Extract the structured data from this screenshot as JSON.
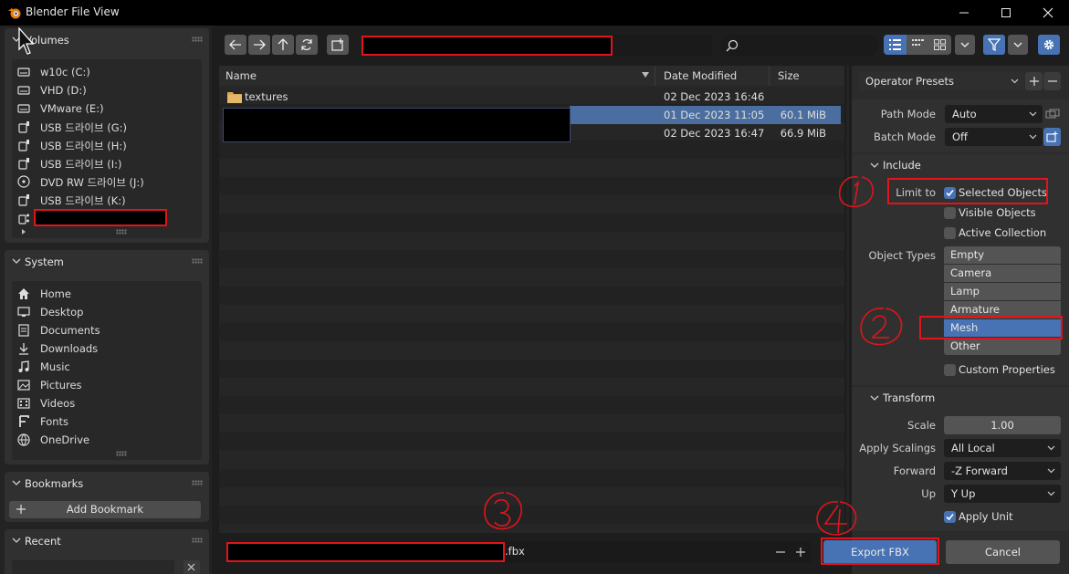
{
  "window": {
    "title": "Blender File View"
  },
  "sidebar": {
    "volumes": {
      "title": "Volumes",
      "items": [
        {
          "label": "w10c (C:)",
          "icon": "disk-icon"
        },
        {
          "label": "VHD (D:)",
          "icon": "disk-icon"
        },
        {
          "label": "VMware (E:)",
          "icon": "disk-icon"
        },
        {
          "label": "USB 드라이브 (G:)",
          "icon": "usb-drive-icon"
        },
        {
          "label": "USB 드라이브 (H:)",
          "icon": "usb-drive-icon"
        },
        {
          "label": "USB 드라이브 (I:)",
          "icon": "usb-drive-icon"
        },
        {
          "label": "DVD RW 드라이브 (J:)",
          "icon": "disc-icon"
        },
        {
          "label": "USB 드라이브 (K:)",
          "icon": "usb-drive-icon"
        }
      ]
    },
    "system": {
      "title": "System",
      "items": [
        {
          "label": "Home",
          "icon": "home-icon"
        },
        {
          "label": "Desktop",
          "icon": "desktop-icon"
        },
        {
          "label": "Documents",
          "icon": "documents-icon"
        },
        {
          "label": "Downloads",
          "icon": "downloads-icon"
        },
        {
          "label": "Music",
          "icon": "music-icon"
        },
        {
          "label": "Pictures",
          "icon": "pictures-icon"
        },
        {
          "label": "Videos",
          "icon": "videos-icon"
        },
        {
          "label": "Fonts",
          "icon": "fonts-icon"
        },
        {
          "label": "OneDrive",
          "icon": "onedrive-icon"
        }
      ]
    },
    "bookmarks": {
      "title": "Bookmarks",
      "add_label": "Add Bookmark"
    },
    "recent": {
      "title": "Recent"
    }
  },
  "file_list": {
    "columns": {
      "name": "Name",
      "date": "Date Modified",
      "size": "Size"
    },
    "rows": [
      {
        "name": "textures",
        "date": "02 Dec 2023 16:46",
        "size": "",
        "selected": false
      },
      {
        "name": "",
        "date": "01 Dec 2023 11:05",
        "size": "60.1 MiB",
        "selected": true
      },
      {
        "name": "",
        "date": "02 Dec 2023 16:47",
        "size": "66.9 MiB",
        "selected": false
      }
    ]
  },
  "filename": {
    "extension": ".fbx"
  },
  "operator": {
    "presets_label": "Operator Presets",
    "path_mode_label": "Path Mode",
    "path_mode_value": "Auto",
    "batch_mode_label": "Batch Mode",
    "batch_mode_value": "Off",
    "include": {
      "title": "Include",
      "limit_to_label": "Limit to",
      "selected_objects": "Selected Objects",
      "visible_objects": "Visible Objects",
      "active_collection": "Active Collection",
      "object_types_label": "Object Types",
      "object_types": [
        "Empty",
        "Camera",
        "Lamp",
        "Armature",
        "Mesh",
        "Other"
      ],
      "selected_type": "Mesh",
      "custom_properties": "Custom Properties"
    },
    "transform": {
      "title": "Transform",
      "scale_label": "Scale",
      "scale_value": "1.00",
      "apply_scalings_label": "Apply Scalings",
      "apply_scalings_value": "All Local",
      "forward_label": "Forward",
      "forward_value": "-Z Forward",
      "up_label": "Up",
      "up_value": "Y Up",
      "apply_unit": "Apply Unit"
    }
  },
  "actions": {
    "export_label": "Export FBX",
    "cancel_label": "Cancel"
  },
  "colors": {
    "accent": "#4772b3",
    "selection_row": "#4a6ea0",
    "annotation_red": "#e0151b"
  }
}
